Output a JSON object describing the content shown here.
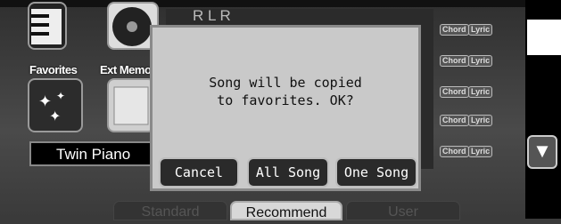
{
  "tiles": {
    "favorites_label": "Favorites",
    "ext_memory_label": "Ext Memo"
  },
  "song_name": "Twin Piano",
  "song_title_partial": "R  L  R",
  "chord_lyric": {
    "chord": "Chord",
    "lyric": "Lyric"
  },
  "dialog": {
    "message_line1": "Song will be copied",
    "message_line2": "to favorites. OK?",
    "buttons": {
      "cancel": "Cancel",
      "all_song": "All Song",
      "one_song": "One Song"
    }
  },
  "tabs": [
    {
      "label": "Standard",
      "active": false
    },
    {
      "label": "Recommend",
      "active": true
    },
    {
      "label": "User",
      "active": false
    }
  ],
  "scroll_down_glyph": "▼",
  "colors": {
    "dialog_bg": "#c9c9c9",
    "button_bg": "#2a2a2a",
    "tab_active": "#d8d8d8"
  }
}
